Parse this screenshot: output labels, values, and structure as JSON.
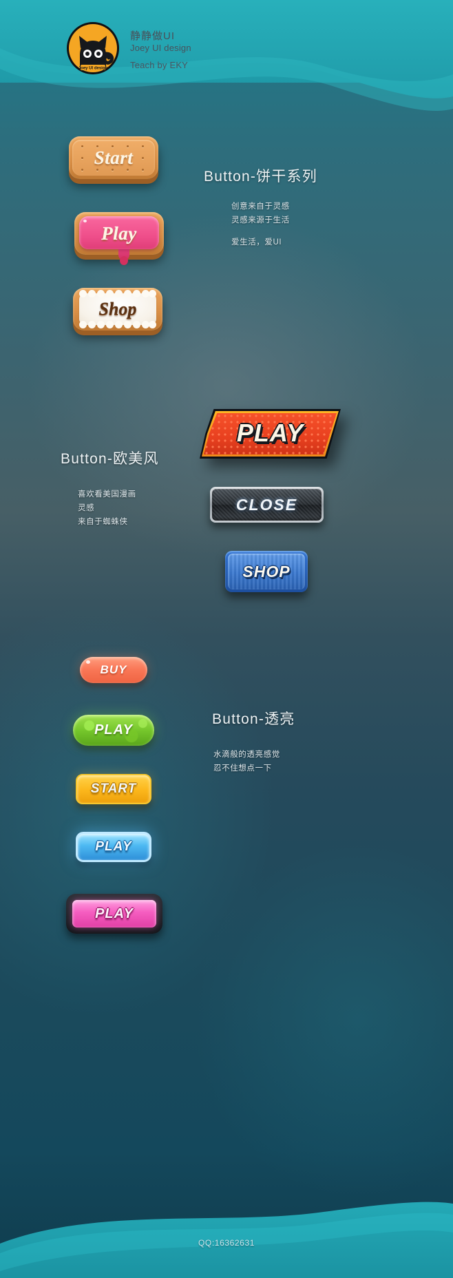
{
  "header": {
    "logo_alt": "cat-logo",
    "logo_badge": "Joey UI design",
    "title_cn": "静静做UI",
    "title_en": "Joey UI design",
    "teach": "Teach by EKY"
  },
  "sections": [
    {
      "id": "cookie",
      "title": "Button-饼干系列",
      "caption_lines": [
        "创意来自于灵感",
        "灵感来源于生活",
        "",
        "爱生活，爱UI"
      ],
      "buttons": [
        {
          "name": "start",
          "label": "Start"
        },
        {
          "name": "play",
          "label": "Play"
        },
        {
          "name": "shop",
          "label": "Shop"
        }
      ]
    },
    {
      "id": "comic",
      "title": "Button-欧美风",
      "caption_lines": [
        "喜欢看美国漫画",
        "灵感",
        "来自于蜘蛛侠"
      ],
      "buttons": [
        {
          "name": "play",
          "label": "PLAY"
        },
        {
          "name": "close",
          "label": "CLOSE"
        },
        {
          "name": "shop",
          "label": "SHOP"
        }
      ]
    },
    {
      "id": "glossy",
      "title": "Button-透亮",
      "caption_lines": [
        "水滴般的透亮感觉",
        "忍不住想点一下"
      ],
      "buttons": [
        {
          "name": "buy",
          "label": "BUY"
        },
        {
          "name": "play-green",
          "label": "PLAY"
        },
        {
          "name": "start-gold",
          "label": "START"
        },
        {
          "name": "play-blue",
          "label": "PLAY"
        },
        {
          "name": "play-pink",
          "label": "PLAY"
        }
      ]
    }
  ],
  "footer": {
    "contact": "QQ:16362631"
  },
  "colors": {
    "bg_top": "#2aa8b4",
    "bg_mid": "#2c5a68",
    "bg_deep": "#16303c",
    "accent_orange": "#f08a1b",
    "accent_pink": "#ef4f8b",
    "accent_blue": "#3a78cf"
  }
}
